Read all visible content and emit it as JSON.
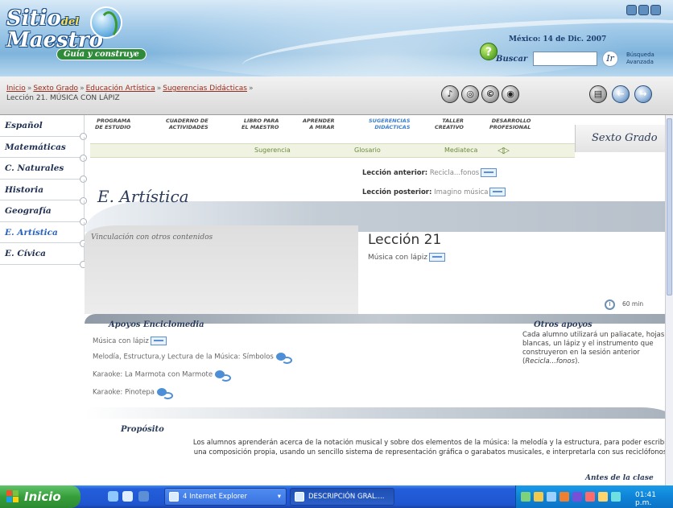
{
  "header": {
    "logo_title": "Sitio",
    "logo_del": "del",
    "logo_title2": "Maestro",
    "logo_subtitle": "Guía y construye",
    "date": "México: 14 de Dic. 2007",
    "search_label": "Buscar",
    "search_value": "",
    "go_label": "Ir",
    "advanced_search": "Búsqueda Avanzada",
    "help_symbol": "?"
  },
  "breadcrumb": {
    "items": [
      "Inicio",
      "Sexto Grado",
      "Educación Artística",
      "Sugerencias Didácticas"
    ],
    "separator": "»",
    "current": "Lección 21. MÚSICA CON LÁPIZ"
  },
  "sidebar": {
    "items": [
      {
        "label": "Español"
      },
      {
        "label": "Matemáticas"
      },
      {
        "label": "C. Naturales"
      },
      {
        "label": "Historia"
      },
      {
        "label": "Geografía"
      },
      {
        "label": "E. Artística"
      },
      {
        "label": "E. Cívica"
      }
    ]
  },
  "topnav": {
    "items": [
      {
        "line1": "PROGRAMA",
        "line2": "DE ESTUDIO"
      },
      {
        "line1": "CUADERNO DE",
        "line2": "ACTIVIDADES"
      },
      {
        "line1": "LIBRO PARA",
        "line2": "EL MAESTRO"
      },
      {
        "line1": "APRENDER",
        "line2": "A MIRAR"
      },
      {
        "line1": "SUGERENCIAS",
        "line2": "DIDÁCTICAS"
      },
      {
        "line1": "TALLER",
        "line2": "CREATIVO"
      },
      {
        "line1": "DESARROLLO",
        "line2": "PROFESIONAL"
      }
    ],
    "grade": "Sexto Grado"
  },
  "subnav": {
    "items": [
      "Sugerencia",
      "Glosario",
      "Mediateca"
    ],
    "arrows": "◁▷"
  },
  "lesson_nav": {
    "prev_label": "Lección anterior:",
    "prev_value": "Recicla...fonos",
    "next_label": "Lección posterior:",
    "next_value": "Imagino música"
  },
  "subject": "E. Artística",
  "vinculacion_title": "Vinculación con otros contenidos",
  "lesson": {
    "title": "Lección 21",
    "subtitle": "Música con lápiz",
    "duration": "60 min"
  },
  "apoyos": {
    "title": "Apoyos Enciclomedia",
    "items": [
      {
        "label": "Música con lápiz",
        "icon": "book-icon"
      },
      {
        "label": "Melodía, Estructura,y Lectura de la Música: Símbolos",
        "icon": "link-icon"
      },
      {
        "label": "Karaoke: La Marmota con Marmote",
        "icon": "link-icon"
      },
      {
        "label": "Karaoke: Pinotepa",
        "icon": "link-icon"
      }
    ]
  },
  "otros_apoyos": {
    "title": "Otros apoyos",
    "text_before": "Cada alumno utilizará un paliacate, hojas blancas, un lápiz y el instrumento que construyeron en la sesión anterior (",
    "text_italic": "Recicla...fonos",
    "text_after": ")."
  },
  "proposito": {
    "title": "Propósito",
    "text": "Los alumnos aprenderán acerca de la notación musical y sobre dos elementos de la música: la melodía y la estructura, para poder escribir una composición propia, usando un sencillo sistema de representación gráfica o garabatos musicales, e interpretarla con sus reciclófonos."
  },
  "antes_de_la_clase": "Antes de la clase",
  "taskbar": {
    "start_label": "Inicio",
    "tasks": [
      {
        "label": "4 Internet Explorer",
        "arrow": "▾"
      },
      {
        "label": "DESCRIPCIÓN GRAL...."
      }
    ],
    "clock": "01:41 p.m."
  },
  "colors": {
    "accent": "#2a63c2",
    "link": "#9a2b1a",
    "heading": "#2c3d5c"
  }
}
